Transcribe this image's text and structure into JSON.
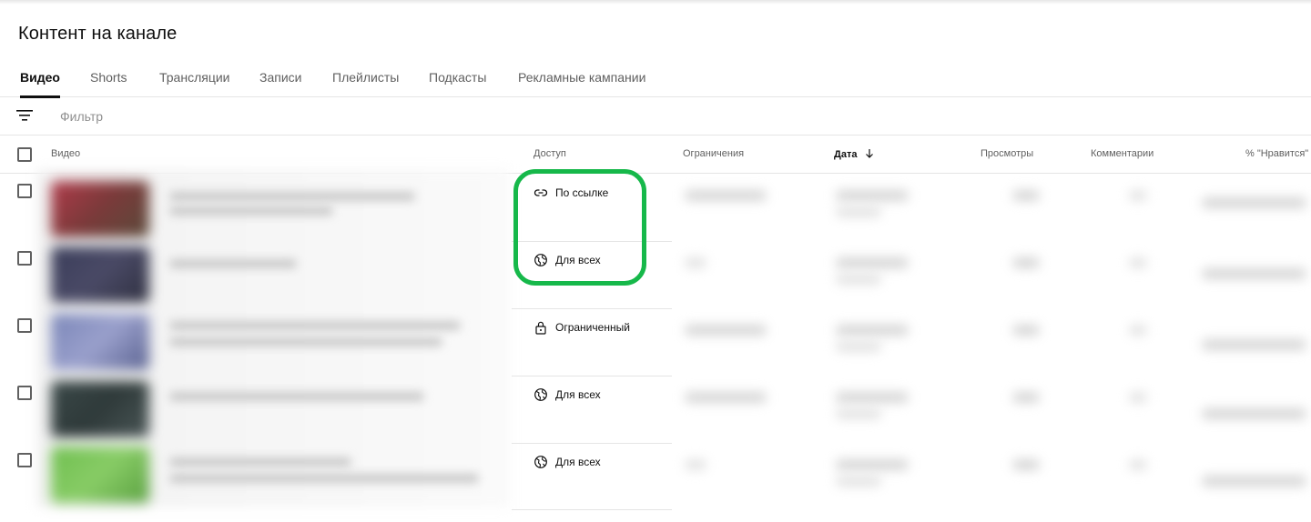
{
  "page": {
    "title": "Контент на канале"
  },
  "tabs": [
    {
      "label": "Видео",
      "active": true
    },
    {
      "label": "Shorts",
      "active": false
    },
    {
      "label": "Трансляции",
      "active": false
    },
    {
      "label": "Записи",
      "active": false
    },
    {
      "label": "Плейлисты",
      "active": false
    },
    {
      "label": "Подкасты",
      "active": false
    },
    {
      "label": "Рекламные кампании",
      "active": false
    }
  ],
  "filter": {
    "placeholder": "Фильтр",
    "icon": "filter-icon"
  },
  "table": {
    "columns": {
      "video": "Видео",
      "access": "Доступ",
      "restrictions": "Ограничения",
      "date": "Дата",
      "views": "Просмотры",
      "comments": "Комментарии",
      "likes": "% \"Нравится\""
    },
    "sort_icon": "arrow-down-icon",
    "rows": [
      {
        "access_label": "По ссылке",
        "access_icon": "link-icon"
      },
      {
        "access_label": "Для всех",
        "access_icon": "globe-icon"
      },
      {
        "access_label": "Ограниченный",
        "access_icon": "lock-icon"
      },
      {
        "access_label": "Для всех",
        "access_icon": "globe-icon"
      },
      {
        "access_label": "Для всех",
        "access_icon": "globe-icon"
      }
    ]
  },
  "colors": {
    "highlight": "#16b84a",
    "text": "#0f0f0f",
    "muted": "#606060",
    "divider": "#e5e5e5"
  }
}
